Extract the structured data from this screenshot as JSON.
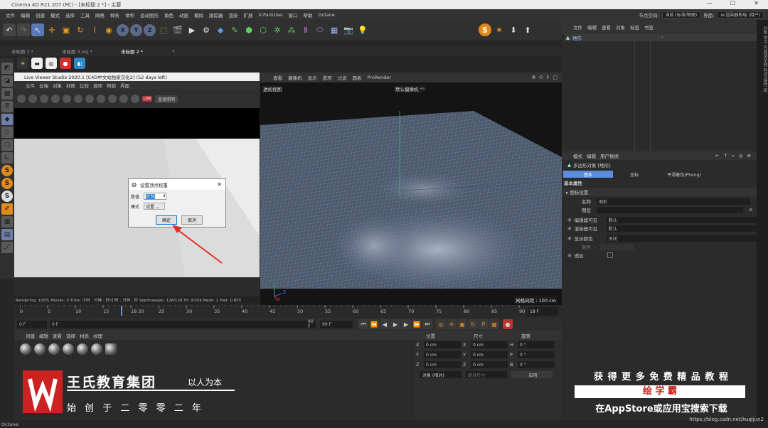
{
  "titlebar": {
    "title": "Cinema 4D R21.207 (RC) - [未标题 2 *] - 主要",
    "min": "—",
    "max": "☐",
    "close": "✕"
  },
  "menubar": {
    "items": [
      "文件",
      "编辑",
      "创建",
      "模式",
      "选择",
      "工具",
      "网格",
      "样条",
      "体积",
      "运动图形",
      "角色",
      "动画",
      "模拟",
      "跟踪器",
      "渲染",
      "扩展",
      "X-Particles",
      "窗口",
      "帮助",
      "Octane"
    ],
    "node_space_label": "节点空间:",
    "node_space_value": "当前 (标准/物理)",
    "layout_label": "界面:",
    "layout_value": "oc渲染器布局 (用户)"
  },
  "tabs": [
    "未标题 1 *",
    "未标题 3.obj *",
    "未标题 2 *",
    "+"
  ],
  "liveviewer": {
    "title": "Live Viewer Studio 2020.1 [C4D中文站独家汉化2] (52 days left)",
    "menu": [
      "文件",
      "云端",
      "对象",
      "材质",
      "比较",
      "选项",
      "帮助",
      "界面"
    ],
    "mode": "直接照明",
    "ldr_label": "LDR",
    "status": "Rendering: 100%   Ms/sec: 0   Time: 小时 : 分钟 : 秒/小时 : 分钟 : 秒   Spp/maxspp: 128/128   Tri: 0/20k   Mesh: 1   Hair: 0   RTX"
  },
  "dialog": {
    "title": "设置顶点权重",
    "value_label": "数值",
    "value": "0 %",
    "mode_label": "模式",
    "mode_value": "设置",
    "ok": "确定",
    "cancel": "取消"
  },
  "viewport": {
    "menu": [
      "查看",
      "摄像机",
      "显示",
      "选项",
      "过滤",
      "面板",
      "ProRender"
    ],
    "view_label": "透视视图",
    "camera_label": "默认摄像机 °°",
    "grid_label": "网格间距 : 100 cm",
    "axis_y": "Y",
    "axis_z": "Z",
    "axis_x": "X"
  },
  "timeline": {
    "ticks": [
      "0",
      "5",
      "10",
      "15",
      "18 20",
      "25",
      "30",
      "35",
      "40",
      "45",
      "50",
      "55",
      "60",
      "65",
      "70",
      "75",
      "80",
      "85",
      "90"
    ],
    "current_frame": "18 F",
    "start": "0 F",
    "start2": "0 F",
    "end": "90 F",
    "end2": "90 F"
  },
  "materials": {
    "menu": [
      "创建",
      "编辑",
      "查看",
      "选择",
      "材质",
      "纹理"
    ]
  },
  "coords": {
    "headers": [
      "位置",
      "尺寸",
      "旋转"
    ],
    "rows": [
      {
        "a": "X",
        "p": "0 cm",
        "b": "X",
        "s": "0 cm",
        "c": "H",
        "r": "0 °"
      },
      {
        "a": "Y",
        "p": "0 cm",
        "b": "Y",
        "s": "0 cm",
        "c": "P",
        "r": "0 °"
      },
      {
        "a": "Z",
        "p": "0 cm",
        "b": "Z",
        "s": "0 cm",
        "c": "B",
        "r": "0 °"
      }
    ],
    "mode": "对象 (相对)",
    "size_mode": "绝对尺寸",
    "apply": "应用"
  },
  "objects": {
    "menu": [
      "文件",
      "编辑",
      "查看",
      "对象",
      "标签",
      "书签"
    ],
    "item": "地形"
  },
  "attributes": {
    "menu": [
      "模式",
      "编辑",
      "用户数据"
    ],
    "object_label": "多边形对象 [地形]",
    "tabs": [
      "基本",
      "坐标",
      "平滑着色(Phong)"
    ],
    "section": "基本属性",
    "subsection": "▸ 图标设置",
    "name_label": "名称",
    "name_value": "地形",
    "layer_label": "图层",
    "editor_visible_label": "编辑器可见",
    "editor_visible_value": "默认",
    "render_visible_label": "渲染器可见",
    "render_visible_value": "默认",
    "display_color_label": "显示颜色",
    "display_color_value": "关闭",
    "color_label": "颜色",
    "xray_label": "透显"
  },
  "rightstrip": "对象  场次  内容浏览器  构造  属性  层",
  "logo": {
    "name": "王氏教育集团",
    "slogan": "以人为本",
    "since": "始 创 于 二 零 零 二 年"
  },
  "promo": {
    "line1": "获 得 更 多 免 费 精 品 教 程",
    "brand": "绘 学 霸",
    "line3_a": "在AppStore或",
    "line3_b": "应用宝",
    "line3_c": "搜索下载"
  },
  "statusbar": "Octane:",
  "watermark": "https://blog.csdn.net/kuqijun2",
  "colors": {
    "accent": "#5b8ddc",
    "red": "#cc2222",
    "arrow": "#e03030"
  }
}
